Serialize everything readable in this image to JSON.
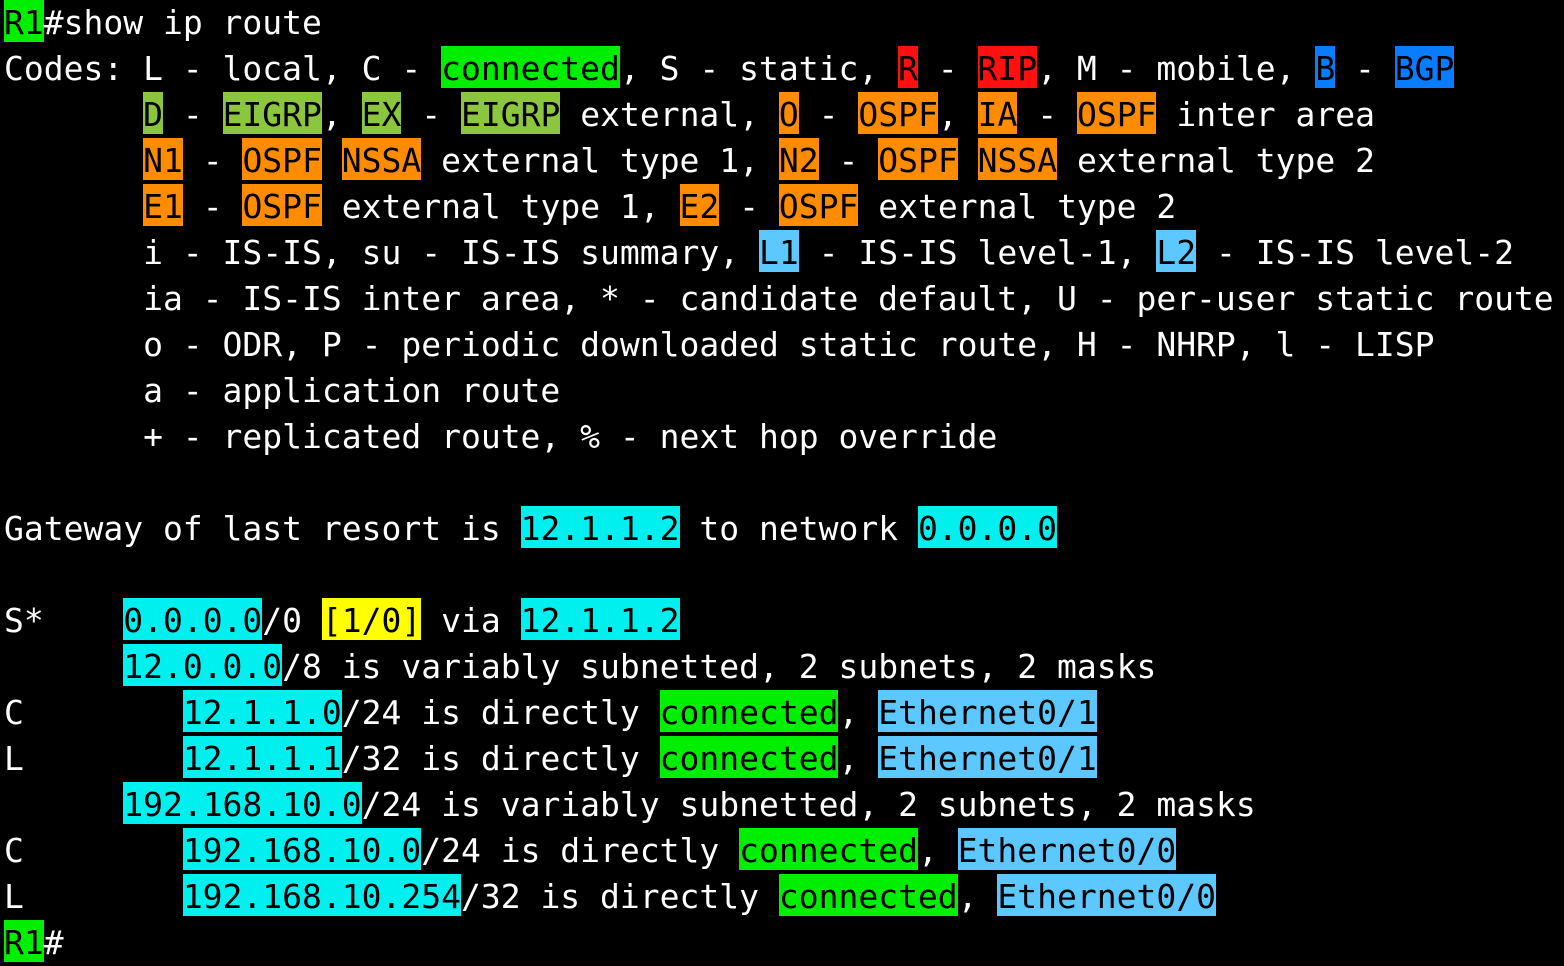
{
  "terminal": {
    "lines": [
      {
        "segs": [
          {
            "t": "R1",
            "hl": "green"
          },
          {
            "t": "#show ip route"
          }
        ]
      },
      {
        "segs": [
          {
            "t": "Codes: L - local, C - "
          },
          {
            "t": "connected",
            "hl": "green"
          },
          {
            "t": ", S - static, "
          },
          {
            "t": "R",
            "hl": "red"
          },
          {
            "t": " - "
          },
          {
            "t": "RIP",
            "hl": "red"
          },
          {
            "t": ", M - mobile, "
          },
          {
            "t": "B",
            "hl": "blue"
          },
          {
            "t": " - "
          },
          {
            "t": "BGP",
            "hl": "blue"
          }
        ]
      },
      {
        "segs": [
          {
            "t": "       "
          },
          {
            "t": "D",
            "hl": "olive"
          },
          {
            "t": " - "
          },
          {
            "t": "EIGRP",
            "hl": "olive"
          },
          {
            "t": ", "
          },
          {
            "t": "EX",
            "hl": "olive"
          },
          {
            "t": " - "
          },
          {
            "t": "EIGRP",
            "hl": "olive"
          },
          {
            "t": " external, "
          },
          {
            "t": "O",
            "hl": "orange"
          },
          {
            "t": " - "
          },
          {
            "t": "OSPF",
            "hl": "orange"
          },
          {
            "t": ", "
          },
          {
            "t": "IA",
            "hl": "orange"
          },
          {
            "t": " - "
          },
          {
            "t": "OSPF",
            "hl": "orange"
          },
          {
            "t": " inter area"
          }
        ]
      },
      {
        "segs": [
          {
            "t": "       "
          },
          {
            "t": "N1",
            "hl": "orange"
          },
          {
            "t": " - "
          },
          {
            "t": "OSPF",
            "hl": "orange"
          },
          {
            "t": " "
          },
          {
            "t": "NSSA",
            "hl": "orange"
          },
          {
            "t": " external type 1, "
          },
          {
            "t": "N2",
            "hl": "orange"
          },
          {
            "t": " - "
          },
          {
            "t": "OSPF",
            "hl": "orange"
          },
          {
            "t": " "
          },
          {
            "t": "NSSA",
            "hl": "orange"
          },
          {
            "t": " external type 2"
          }
        ]
      },
      {
        "segs": [
          {
            "t": "       "
          },
          {
            "t": "E1",
            "hl": "orange"
          },
          {
            "t": " - "
          },
          {
            "t": "OSPF",
            "hl": "orange"
          },
          {
            "t": " external type 1, "
          },
          {
            "t": "E2",
            "hl": "orange"
          },
          {
            "t": " - "
          },
          {
            "t": "OSPF",
            "hl": "orange"
          },
          {
            "t": " external type 2"
          }
        ]
      },
      {
        "segs": [
          {
            "t": "       i - IS-IS, su - IS-IS summary, "
          },
          {
            "t": "L1",
            "hl": "sky"
          },
          {
            "t": " - IS-IS level-1, "
          },
          {
            "t": "L2",
            "hl": "sky"
          },
          {
            "t": " - IS-IS level-2"
          }
        ]
      },
      {
        "segs": [
          {
            "t": "       ia - IS-IS inter area, * - candidate default, U - per-user static route"
          }
        ]
      },
      {
        "segs": [
          {
            "t": "       o - ODR, P - periodic downloaded static route, H - NHRP, l - LISP"
          }
        ]
      },
      {
        "segs": [
          {
            "t": "       a - application route"
          }
        ]
      },
      {
        "segs": [
          {
            "t": "       + - replicated route, % - next hop override"
          }
        ]
      },
      {
        "segs": [
          {
            "t": ""
          }
        ]
      },
      {
        "segs": [
          {
            "t": "Gateway of last resort is "
          },
          {
            "t": "12.1.1.2",
            "hl": "cyan"
          },
          {
            "t": " to network "
          },
          {
            "t": "0.0.0.0",
            "hl": "cyan"
          }
        ]
      },
      {
        "segs": [
          {
            "t": ""
          }
        ]
      },
      {
        "segs": [
          {
            "t": "S*    "
          },
          {
            "t": "0.0.0.0",
            "hl": "cyan"
          },
          {
            "t": "/0 "
          },
          {
            "t": "[1/0]",
            "hl": "yellow"
          },
          {
            "t": " via "
          },
          {
            "t": "12.1.1.2",
            "hl": "cyan"
          }
        ]
      },
      {
        "segs": [
          {
            "t": "      "
          },
          {
            "t": "12.0.0.0",
            "hl": "cyan"
          },
          {
            "t": "/8 is variably subnetted, 2 subnets, 2 masks"
          }
        ]
      },
      {
        "segs": [
          {
            "t": "C        "
          },
          {
            "t": "12.1.1.0",
            "hl": "cyan"
          },
          {
            "t": "/24 is directly "
          },
          {
            "t": "connected",
            "hl": "green"
          },
          {
            "t": ", "
          },
          {
            "t": "Ethernet0/1",
            "hl": "sky"
          }
        ]
      },
      {
        "segs": [
          {
            "t": "L        "
          },
          {
            "t": "12.1.1.1",
            "hl": "cyan"
          },
          {
            "t": "/32 is directly "
          },
          {
            "t": "connected",
            "hl": "green"
          },
          {
            "t": ", "
          },
          {
            "t": "Ethernet0/1",
            "hl": "sky"
          }
        ]
      },
      {
        "segs": [
          {
            "t": "      "
          },
          {
            "t": "192.168.10.0",
            "hl": "cyan"
          },
          {
            "t": "/24 is variably subnetted, 2 subnets, 2 masks"
          }
        ]
      },
      {
        "segs": [
          {
            "t": "C        "
          },
          {
            "t": "192.168.10.0",
            "hl": "cyan"
          },
          {
            "t": "/24 is directly "
          },
          {
            "t": "connected",
            "hl": "green"
          },
          {
            "t": ", "
          },
          {
            "t": "Ethernet0/0",
            "hl": "sky"
          }
        ]
      },
      {
        "segs": [
          {
            "t": "L        "
          },
          {
            "t": "192.168.10.254",
            "hl": "cyan"
          },
          {
            "t": "/32 is directly "
          },
          {
            "t": "connected",
            "hl": "green"
          },
          {
            "t": ", "
          },
          {
            "t": "Ethernet0/0",
            "hl": "sky"
          }
        ]
      },
      {
        "segs": [
          {
            "t": "R1",
            "hl": "green"
          },
          {
            "t": "#"
          }
        ]
      }
    ]
  },
  "colors": {
    "background": "#000000",
    "text": "#ffffff",
    "green": "#00ee00",
    "red": "#ff1010",
    "blue": "#0a7cff",
    "olive": "#8cc63f",
    "orange": "#ff8c00",
    "sky": "#5cc8ff",
    "cyan": "#00f0f0",
    "yellow": "#ffff00"
  }
}
